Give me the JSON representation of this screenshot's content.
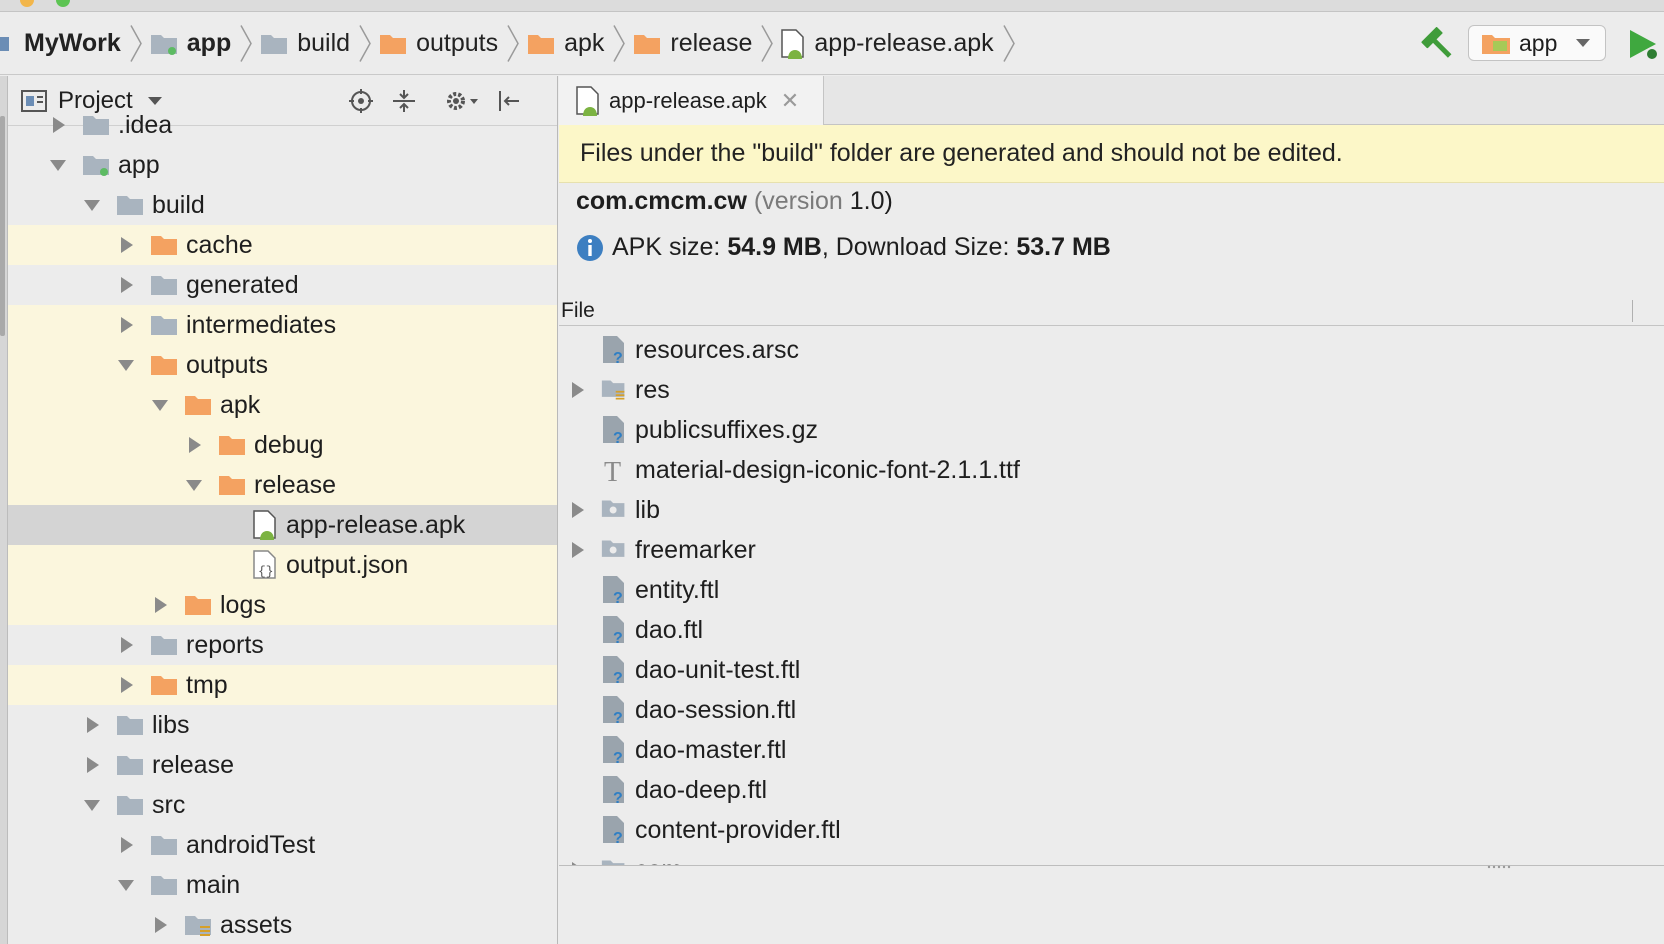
{
  "breadcrumb": [
    {
      "label": "MyWork",
      "bold": true,
      "icon": "module-icon"
    },
    {
      "label": "app",
      "bold": true,
      "icon": "app-module-icon"
    },
    {
      "label": "build",
      "bold": false,
      "icon": "folder-icon"
    },
    {
      "label": "outputs",
      "bold": false,
      "icon": "orange-folder-icon"
    },
    {
      "label": "apk",
      "bold": false,
      "icon": "orange-folder-icon"
    },
    {
      "label": "release",
      "bold": false,
      "icon": "orange-folder-icon"
    },
    {
      "label": "app-release.apk",
      "bold": false,
      "icon": "apk-file-icon"
    }
  ],
  "toolbar": {
    "run_config": "app",
    "build_icon": "hammer-icon",
    "run_icon": "run-icon"
  },
  "project_panel": {
    "title": "Project",
    "tools": [
      "locate-icon",
      "collapse-all-icon",
      "settings-icon",
      "hide-icon"
    ]
  },
  "tree": [
    {
      "label": ".idea",
      "depth": 1,
      "expanded": false,
      "icon": "folder",
      "highlight": false
    },
    {
      "label": "app",
      "depth": 1,
      "expanded": true,
      "icon": "module",
      "highlight": false
    },
    {
      "label": "build",
      "depth": 2,
      "expanded": true,
      "icon": "folder",
      "highlight": false
    },
    {
      "label": "cache",
      "depth": 3,
      "expanded": false,
      "icon": "orange",
      "highlight": true
    },
    {
      "label": "generated",
      "depth": 3,
      "expanded": false,
      "icon": "folder",
      "highlight": false
    },
    {
      "label": "intermediates",
      "depth": 3,
      "expanded": false,
      "icon": "folder",
      "highlight": true
    },
    {
      "label": "outputs",
      "depth": 3,
      "expanded": true,
      "icon": "orange",
      "highlight": true
    },
    {
      "label": "apk",
      "depth": 4,
      "expanded": true,
      "icon": "orange",
      "highlight": true
    },
    {
      "label": "debug",
      "depth": 5,
      "expanded": false,
      "icon": "orange",
      "highlight": true
    },
    {
      "label": "release",
      "depth": 5,
      "expanded": true,
      "icon": "orange",
      "highlight": true
    },
    {
      "label": "app-release.apk",
      "depth": 6,
      "expanded": null,
      "icon": "apk",
      "highlight": false,
      "selected": true
    },
    {
      "label": "output.json",
      "depth": 6,
      "expanded": null,
      "icon": "json",
      "highlight": true
    },
    {
      "label": "logs",
      "depth": 4,
      "expanded": false,
      "icon": "orange",
      "highlight": true
    },
    {
      "label": "reports",
      "depth": 3,
      "expanded": false,
      "icon": "folder",
      "highlight": false
    },
    {
      "label": "tmp",
      "depth": 3,
      "expanded": false,
      "icon": "orange",
      "highlight": true
    },
    {
      "label": "libs",
      "depth": 2,
      "expanded": false,
      "icon": "folder",
      "highlight": false
    },
    {
      "label": "release",
      "depth": 2,
      "expanded": false,
      "icon": "folder",
      "highlight": false
    },
    {
      "label": "src",
      "depth": 2,
      "expanded": true,
      "icon": "folder",
      "highlight": false
    },
    {
      "label": "androidTest",
      "depth": 3,
      "expanded": false,
      "icon": "folder",
      "highlight": false
    },
    {
      "label": "main",
      "depth": 3,
      "expanded": true,
      "icon": "folder",
      "highlight": false
    },
    {
      "label": "assets",
      "depth": 4,
      "expanded": false,
      "icon": "assets",
      "highlight": false
    }
  ],
  "editor": {
    "tab_label": "app-release.apk",
    "banner": "Files under the \"build\" folder are generated and should not be edited.",
    "package_name": "com.cmcm.cw",
    "version_prefix": "(version",
    "version_value": "1.0)",
    "apk_size_label": "APK size:",
    "apk_size_value": "54.9 MB",
    "download_size_label": ", Download Size:",
    "download_size_value": "53.7 MB",
    "table_header": "File",
    "files": [
      {
        "label": "resources.arsc",
        "kind": "unknown",
        "expandable": false
      },
      {
        "label": "res",
        "kind": "resfolder",
        "expandable": true
      },
      {
        "label": "publicsuffixes.gz",
        "kind": "unknown",
        "expandable": false
      },
      {
        "label": "material-design-iconic-font-2.1.1.ttf",
        "kind": "font",
        "expandable": false
      },
      {
        "label": "lib",
        "kind": "pkgfolder",
        "expandable": true
      },
      {
        "label": "freemarker",
        "kind": "pkgfolder",
        "expandable": true
      },
      {
        "label": "entity.ftl",
        "kind": "unknown",
        "expandable": false
      },
      {
        "label": "dao.ftl",
        "kind": "unknown",
        "expandable": false
      },
      {
        "label": "dao-unit-test.ftl",
        "kind": "unknown",
        "expandable": false
      },
      {
        "label": "dao-session.ftl",
        "kind": "unknown",
        "expandable": false
      },
      {
        "label": "dao-master.ftl",
        "kind": "unknown",
        "expandable": false
      },
      {
        "label": "dao-deep.ftl",
        "kind": "unknown",
        "expandable": false
      },
      {
        "label": "content-provider.ftl",
        "kind": "unknown",
        "expandable": false
      },
      {
        "label": "com",
        "kind": "pkgfolder",
        "expandable": true
      }
    ]
  },
  "colors": {
    "highlight_row": "#fbf6dd",
    "selected_row": "#d4d4d4",
    "banner_bg": "#fcf7c8",
    "orange_folder": "#f4a261",
    "grey_folder": "#a9b4bf",
    "run_green": "#3fa83f"
  }
}
